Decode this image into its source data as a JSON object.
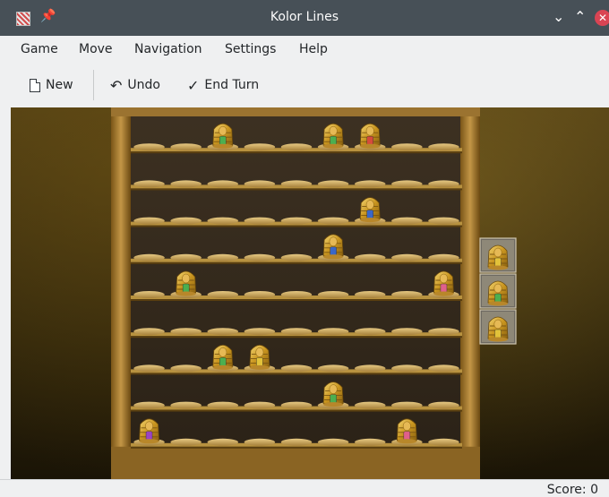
{
  "window": {
    "title": "Kolor Lines"
  },
  "menu": [
    "Game",
    "Move",
    "Navigation",
    "Settings",
    "Help"
  ],
  "toolbar": {
    "new_label": "New",
    "undo_label": "Undo",
    "end_turn_label": "End Turn"
  },
  "board": {
    "rows": 9,
    "cols": 9,
    "pieces": [
      {
        "row": 0,
        "col": 2,
        "color": "green"
      },
      {
        "row": 0,
        "col": 5,
        "color": "green"
      },
      {
        "row": 0,
        "col": 6,
        "color": "red"
      },
      {
        "row": 2,
        "col": 6,
        "color": "blue"
      },
      {
        "row": 3,
        "col": 5,
        "color": "blue"
      },
      {
        "row": 4,
        "col": 1,
        "color": "green"
      },
      {
        "row": 4,
        "col": 8,
        "color": "pink"
      },
      {
        "row": 6,
        "col": 2,
        "color": "green"
      },
      {
        "row": 6,
        "col": 3,
        "color": "yellow"
      },
      {
        "row": 7,
        "col": 5,
        "color": "green"
      },
      {
        "row": 8,
        "col": 0,
        "color": "purple"
      },
      {
        "row": 8,
        "col": 7,
        "color": "pink"
      }
    ],
    "next_pieces": [
      {
        "color": "yellow"
      },
      {
        "color": "green"
      },
      {
        "color": "yellow"
      }
    ],
    "colors": {
      "green": "#4caf50",
      "red": "#d64b3b",
      "blue": "#3a67c8",
      "pink": "#e0608a",
      "yellow": "#e2c23a",
      "purple": "#9b44c2",
      "gold": "#d9a92c",
      "wood": "#a87a2d"
    }
  },
  "status": {
    "score": "Score: 0"
  }
}
